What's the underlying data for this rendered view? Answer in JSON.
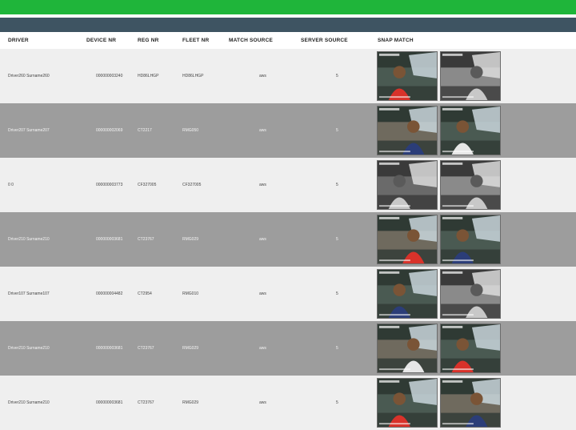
{
  "colors": {
    "top_bar": "#1fb53a",
    "nav_bar": "#3e5462",
    "row_light": "#efefef",
    "row_dark": "#9d9d9d"
  },
  "table": {
    "headers": [
      "DRIVER",
      "DEVICE NR",
      "REG NR",
      "FLEET NR",
      "MATCH SOURCE",
      "SERVER SOURCE",
      "SNAP MATCH"
    ],
    "rows": [
      {
        "driver": "Driver260 Surname260",
        "device": "000000003240",
        "reg": "HD86LHGP",
        "fleet": "HD86LHGP",
        "match": "aws",
        "server": "5",
        "style": "light",
        "snap1": "color",
        "snap2": "grey"
      },
      {
        "driver": "Driver207 Surname207",
        "device": "000000002069",
        "reg": "CT2217",
        "fleet": "RMG050",
        "match": "aws",
        "server": "5",
        "style": "dark",
        "snap1": "color",
        "snap2": "color"
      },
      {
        "driver": "0 0",
        "device": "000000003773",
        "reg": "CF327005",
        "fleet": "CF327005",
        "match": "aws",
        "server": "5",
        "style": "light",
        "snap1": "grey",
        "snap2": "grey"
      },
      {
        "driver": "Driver210 Surname210",
        "device": "000000003681",
        "reg": "CT23767",
        "fleet": "RMG029",
        "match": "aws",
        "server": "5",
        "style": "dark",
        "snap1": "color",
        "snap2": "color"
      },
      {
        "driver": "Driver107 Surname107",
        "device": "000000004482",
        "reg": "CT2954",
        "fleet": "RMG010",
        "match": "aws",
        "server": "5",
        "style": "light",
        "snap1": "color",
        "snap2": "grey"
      },
      {
        "driver": "Driver210 Surname210",
        "device": "000000003681",
        "reg": "CT23767",
        "fleet": "RMG029",
        "match": "aws",
        "server": "5",
        "style": "dark",
        "snap1": "color",
        "snap2": "color"
      },
      {
        "driver": "Driver210 Surname210",
        "device": "000000003681",
        "reg": "CT23767",
        "fleet": "RMG029",
        "match": "aws",
        "server": "5",
        "style": "light",
        "snap1": "color",
        "snap2": "color"
      }
    ]
  }
}
